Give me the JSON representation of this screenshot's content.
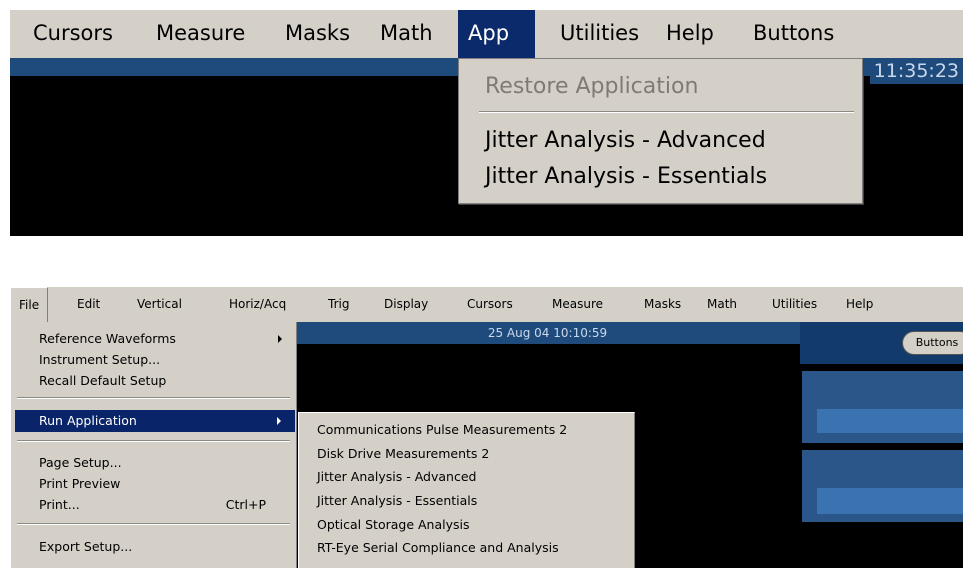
{
  "top": {
    "menu_items": [
      "Cursors",
      "Measure",
      "Masks",
      "Math",
      "App",
      "Utilities",
      "Help",
      "Buttons"
    ],
    "clock": "11:35:23",
    "dropdown": {
      "disabled_item": "Restore Application",
      "items": [
        "Jitter Analysis - Advanced",
        "Jitter Analysis - Essentials"
      ]
    }
  },
  "bottom": {
    "menu_items": [
      "File",
      "Edit",
      "Vertical",
      "Horiz/Acq",
      "Trig",
      "Display",
      "Cursors",
      "Measure",
      "Masks",
      "Math",
      "Utilities",
      "Help"
    ],
    "datetime": "25 Aug 04 10:10:59",
    "buttons_label": "Buttons",
    "file_menu": {
      "items": [
        {
          "label": "Reference Waveforms",
          "submenu": true
        },
        {
          "label": "Instrument Setup..."
        },
        {
          "label": "Recall Default Setup"
        },
        {
          "label": "Run Application",
          "submenu": true,
          "selected": true
        },
        {
          "label": "Page Setup..."
        },
        {
          "label": "Print Preview"
        },
        {
          "label": "Print...",
          "shortcut": "Ctrl+P"
        },
        {
          "label": "Export Setup..."
        }
      ]
    },
    "run_application_submenu": [
      "Communications Pulse Measurements 2",
      "Disk Drive Measurements 2",
      "Jitter Analysis - Advanced",
      "Jitter Analysis - Essentials",
      "Optical Storage Analysis",
      "RT-Eye Serial Compliance and Analysis"
    ]
  },
  "colors": {
    "menu_bg": "#d4d0c8",
    "highlight": "#0a246a",
    "scope_blue": "#1f4a7c",
    "disabled_text": "#7f7b72"
  }
}
